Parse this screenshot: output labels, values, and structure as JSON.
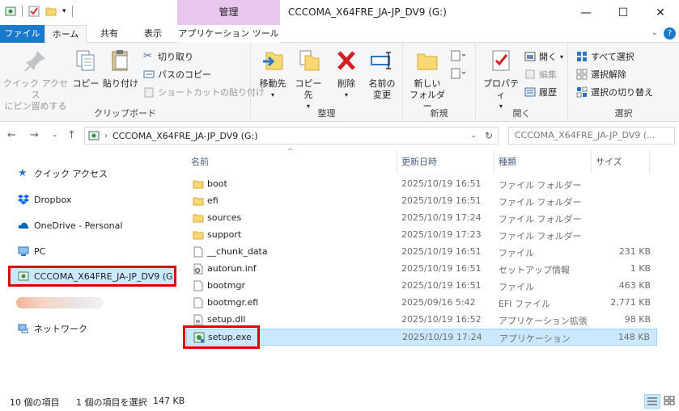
{
  "window": {
    "title": "CCCOMA_X64FRE_JA-JP_DV9 (G:)",
    "context_tab": "管理",
    "minimize": "—",
    "maximize": "☐",
    "close": "✕"
  },
  "tabs": [
    {
      "label": "ファイル"
    },
    {
      "label": "ホーム"
    },
    {
      "label": "共有"
    },
    {
      "label": "表示"
    },
    {
      "label": "アプリケーション ツール"
    }
  ],
  "ribbon": {
    "clipboard": {
      "label": "クリップボード",
      "pin": "クイック アクセス\nにピン留めする",
      "copy": "コピー",
      "paste": "貼り付け",
      "cut": "切り取り",
      "copy_path": "パスのコピー",
      "paste_shortcut": "ショートカットの貼り付け"
    },
    "organize": {
      "label": "整理",
      "move_to": "移動先",
      "copy_to": "コピー先",
      "delete": "削除",
      "rename_1": "名前の",
      "rename_2": "変更"
    },
    "new": {
      "label": "新規",
      "new_folder_1": "新しい",
      "new_folder_2": "フォルダー"
    },
    "open": {
      "label": "開く",
      "properties": "プロパティ",
      "open": "開く",
      "edit": "編集",
      "history": "履歴"
    },
    "select": {
      "label": "選択",
      "select_all": "すべて選択",
      "select_none": "選択解除",
      "invert": "選択の切り替え"
    }
  },
  "address": {
    "path": "CCCOMA_X64FRE_JA-JP_DV9 (G:)",
    "search_placeholder": "CCCOMA_X64FRE_JA-JP_DV9 (..."
  },
  "nav": [
    {
      "label": "クイック アクセス"
    },
    {
      "label": "Dropbox"
    },
    {
      "label": "OneDrive - Personal"
    },
    {
      "label": "PC"
    },
    {
      "label": "CCCOMA_X64FRE_JA-JP_DV9 (G:)"
    },
    {
      "label": "ネットワーク"
    }
  ],
  "columns": {
    "name": "名前",
    "date": "更新日時",
    "type": "種類",
    "size": "サイズ"
  },
  "files": [
    {
      "name": "boot",
      "date": "2025/10/19 16:51",
      "type": "ファイル フォルダー",
      "size": "",
      "icon": "folder-icon"
    },
    {
      "name": "efi",
      "date": "2025/10/19 16:51",
      "type": "ファイル フォルダー",
      "size": "",
      "icon": "folder-icon"
    },
    {
      "name": "sources",
      "date": "2025/10/19 17:24",
      "type": "ファイル フォルダー",
      "size": "",
      "icon": "folder-icon"
    },
    {
      "name": "support",
      "date": "2025/10/19 17:23",
      "type": "ファイル フォルダー",
      "size": "",
      "icon": "folder-icon"
    },
    {
      "name": "__chunk_data",
      "date": "2025/10/19 16:51",
      "type": "ファイル",
      "size": "231 KB",
      "icon": "file-icon"
    },
    {
      "name": "autorun.inf",
      "date": "2025/10/19 16:51",
      "type": "セットアップ情報",
      "size": "1 KB",
      "icon": "settings-file-icon"
    },
    {
      "name": "bootmgr",
      "date": "2025/10/19 16:51",
      "type": "ファイル",
      "size": "463 KB",
      "icon": "file-icon"
    },
    {
      "name": "bootmgr.efi",
      "date": "2025/09/16 5:42",
      "type": "EFI ファイル",
      "size": "2,771 KB",
      "icon": "file-icon"
    },
    {
      "name": "setup.dll",
      "date": "2025/10/19 16:52",
      "type": "アプリケーション拡張",
      "size": "98 KB",
      "icon": "dll-file-icon"
    },
    {
      "name": "setup.exe",
      "date": "2025/10/19 17:24",
      "type": "アプリケーション",
      "size": "148 KB",
      "icon": "setup-app-icon"
    }
  ],
  "status": {
    "count": "10 個の項目",
    "selected": "1 個の項目を選択",
    "size": "147 KB"
  },
  "colors": {
    "file_tab": "#1979ca",
    "context_tab": "#e8c6f0",
    "selection": "#cce8ff",
    "highlight_box": "#e00000",
    "folder": "#f8d775"
  }
}
